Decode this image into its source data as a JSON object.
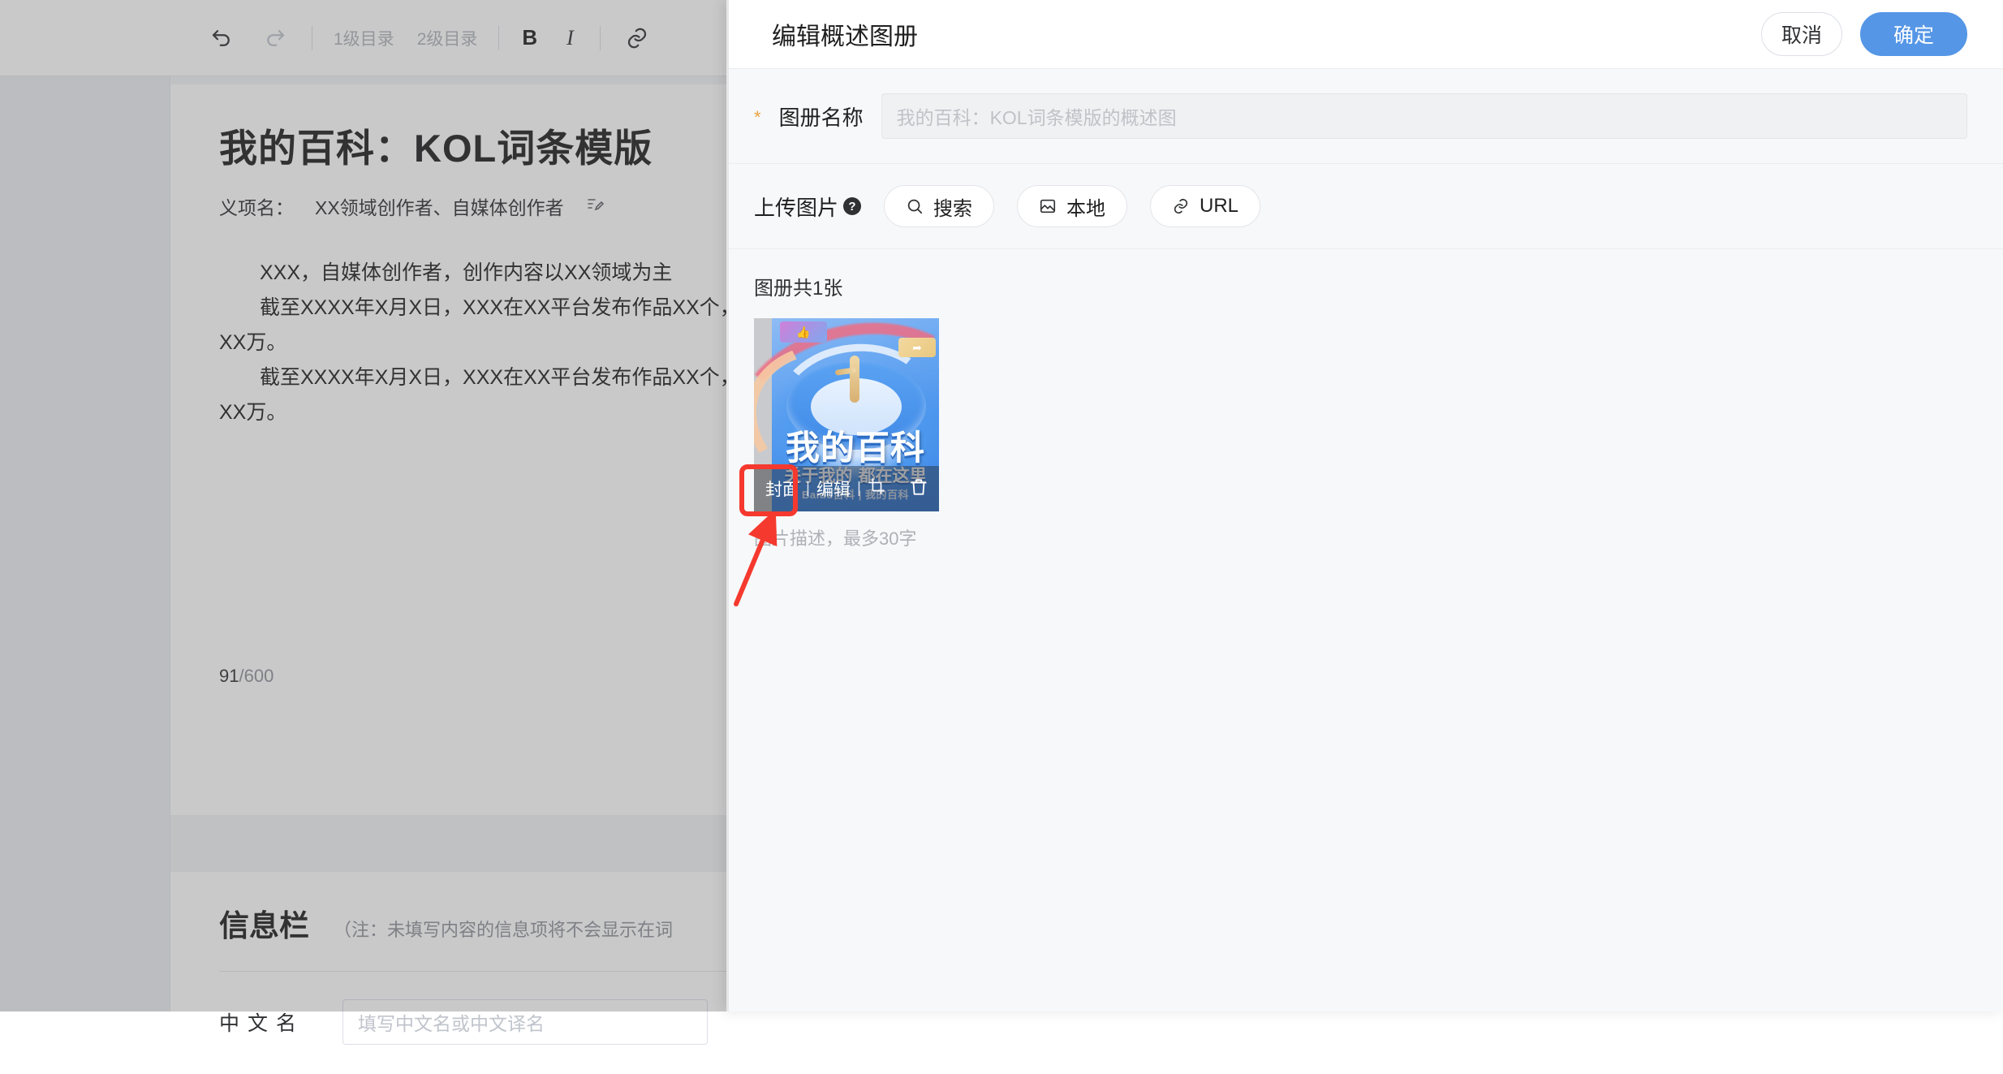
{
  "background": {
    "toolbar": {
      "undo_icon": "undo-icon",
      "redo_icon": "redo-icon",
      "heading1": "1级目录",
      "heading2": "2级目录",
      "bold": "B",
      "italic": "I",
      "link_icon": "link-icon"
    },
    "document": {
      "title": "我的百科：KOL词条模版",
      "sense_label": "义项名：",
      "sense_value": "XX领域创作者、自媒体创作者",
      "edit_icon": "edit-pencil-icon",
      "paragraphs": [
        "XXX，自媒体创作者，创作内容以XX领域为主",
        "截至XXXX年X月X日，XXX在XX平台发布作品XX个，累计获赞XX万。",
        "截至XXXX年X月X日，XXX在XX平台发布作品XX个，累计获赞XX万。"
      ],
      "counter_current": "91",
      "counter_max": "/600"
    },
    "infobar": {
      "title": "信息栏",
      "note": "（注：未填写内容的信息项将不会显示在词",
      "field_label": "中文名",
      "field_placeholder": "填写中文名或中文译名"
    }
  },
  "modal": {
    "title": "编辑概述图册",
    "cancel_label": "取消",
    "confirm_label": "确定",
    "accent_color": "#5596e6",
    "name_field": {
      "required_mark": "*",
      "label": "图册名称",
      "placeholder": "我的百科：KOL词条模版的概述图",
      "value": ""
    },
    "upload": {
      "label": "上传图片",
      "help_icon": "question-mark-icon",
      "help_glyph": "?",
      "buttons": [
        {
          "label": "搜索",
          "icon": "search-icon"
        },
        {
          "label": "本地",
          "icon": "image-icon"
        },
        {
          "label": "URL",
          "icon": "link-icon"
        }
      ]
    },
    "gallery": {
      "count_text": "图册共1张",
      "thumbnail": {
        "image_title": "我的百科",
        "image_subtitle": "关于我的 都在这里",
        "image_watermark": "Baidu百科 | 我的百科",
        "badge_like_icon": "thumbs-up-icon",
        "badge_share_icon": "share-arrow-icon",
        "overlay": {
          "cover_label": "封面",
          "separator": "|",
          "edit_label": "编辑",
          "crop_icon": "crop-icon",
          "delete_icon": "trash-icon"
        },
        "description_placeholder": "图片描述，最多30字",
        "description_value": ""
      }
    }
  },
  "annotations": {
    "highlight_color": "#f5392e",
    "highlight_target": "封面",
    "arrow_icon": "arrow-up-right-icon"
  }
}
